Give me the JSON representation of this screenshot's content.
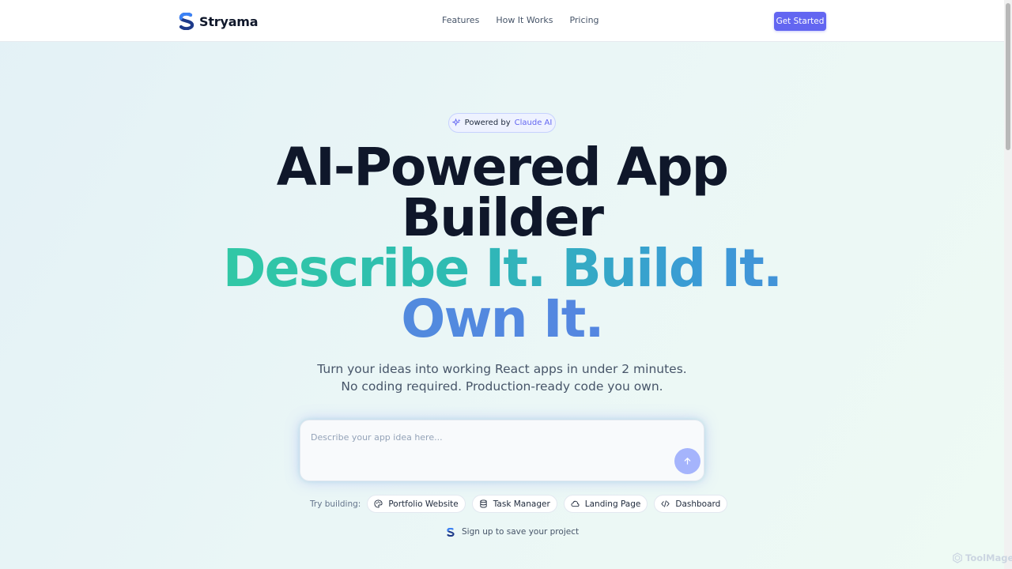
{
  "nav": {
    "brand": "Stryama",
    "links": [
      "Features",
      "How It Works",
      "Pricing"
    ],
    "cta_label": "Get Started"
  },
  "badge": {
    "prefix": "Powered by",
    "accent": "Claude AI"
  },
  "hero": {
    "line1": "AI-Powered App",
    "line2": "Builder",
    "line3": "Describe It. Build It.",
    "line4": "Own It."
  },
  "subtitle": {
    "line1": "Turn your ideas into working React apps in under 2 minutes.",
    "line2": "No coding required. Production-ready code you own."
  },
  "prompt": {
    "placeholder": "Describe your app idea here...",
    "value": ""
  },
  "suggestions": {
    "label": "Try building:",
    "items": [
      {
        "label": "Portfolio Website",
        "icon": "palette-icon"
      },
      {
        "label": "Task Manager",
        "icon": "database-icon"
      },
      {
        "label": "Landing Page",
        "icon": "cloud-icon"
      },
      {
        "label": "Dashboard",
        "icon": "code-icon"
      }
    ]
  },
  "signup_text": "Sign up to save your project",
  "watermark": "ToolMage",
  "colors": {
    "accent": "#6366f1",
    "gradient_start": "#34d399",
    "gradient_end": "#5b7ee6"
  }
}
